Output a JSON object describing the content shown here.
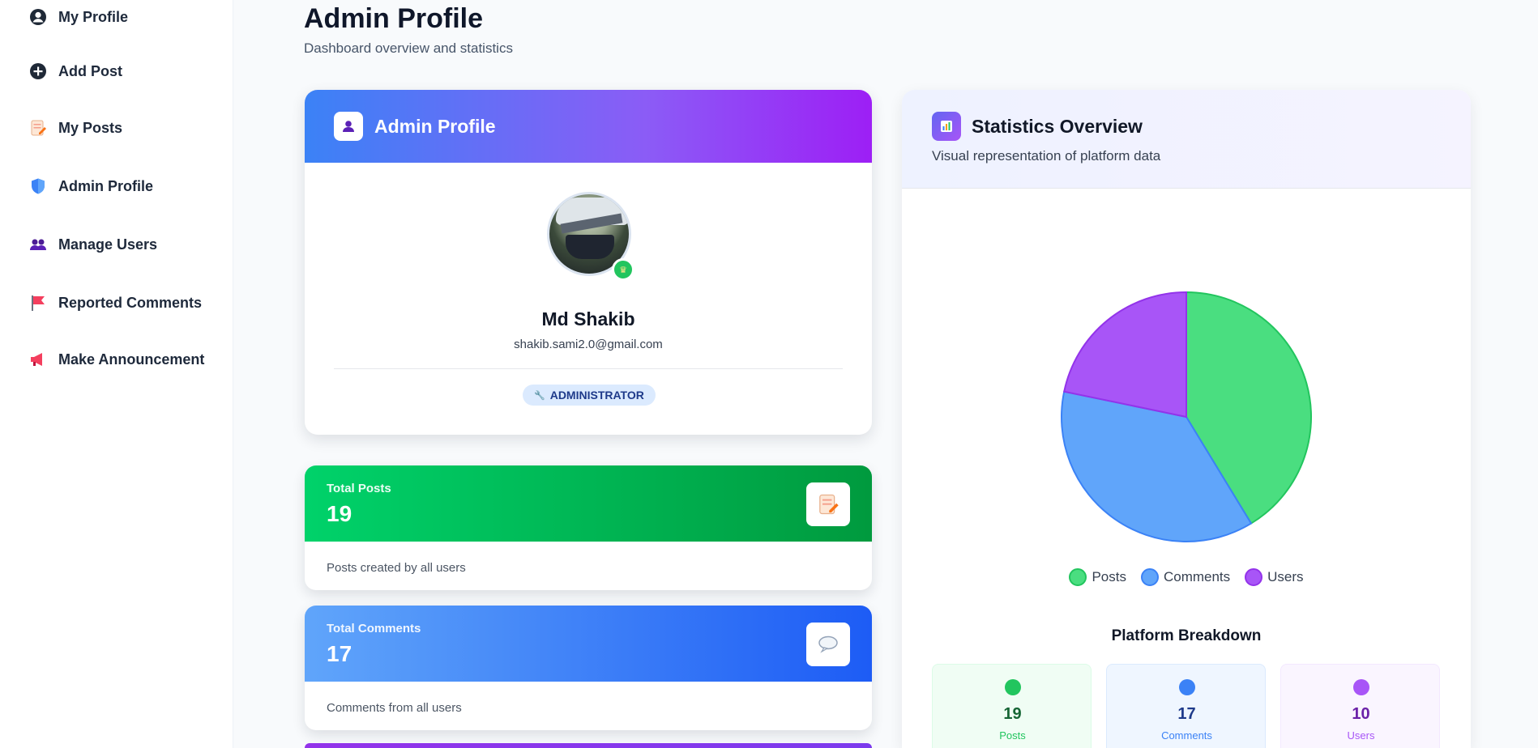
{
  "sidebar": {
    "items": [
      {
        "label": "My Profile",
        "icon": "user-circle-icon"
      },
      {
        "label": "Add Post",
        "icon": "plus-circle-icon"
      },
      {
        "label": "My Posts",
        "icon": "memo-icon"
      },
      {
        "label": "Admin Profile",
        "icon": "shield-icon"
      },
      {
        "label": "Manage Users",
        "icon": "users-icon"
      },
      {
        "label": "Reported Comments",
        "icon": "flag-icon"
      },
      {
        "label": "Make Announcement",
        "icon": "megaphone-icon"
      }
    ]
  },
  "header": {
    "title": "Admin Profile",
    "subtitle": "Dashboard overview and statistics"
  },
  "profile": {
    "card_title": "Admin Profile",
    "name": "Md Shakib",
    "email": "shakib.sami2.0@gmail.com",
    "role": "ADMINISTRATOR"
  },
  "stats_cards": [
    {
      "label": "Total Posts",
      "value": "19",
      "note": "Posts created by all users",
      "icon": "memo-icon",
      "gradient": [
        "#00d26a",
        "#009a3e"
      ]
    },
    {
      "label": "Total Comments",
      "value": "17",
      "note": "Comments from all users",
      "icon": "speech-bubble-icon",
      "gradient": [
        "#60a5fa",
        "#1d5cf5"
      ]
    }
  ],
  "statistics": {
    "title": "Statistics Overview",
    "subtitle": "Visual representation of platform data",
    "breakdown_title": "Platform Breakdown",
    "breakdown": [
      {
        "value": "19",
        "label": "Posts",
        "dot": "#22c55e",
        "bg": "#f0fdf4",
        "border": "#dcfce7",
        "text": "#166534"
      },
      {
        "value": "17",
        "label": "Comments",
        "dot": "#3b82f6",
        "bg": "#eff6ff",
        "border": "#dbeafe",
        "text": "#1e3a8a"
      },
      {
        "value": "10",
        "label": "Users",
        "dot": "#a855f7",
        "bg": "#faf5ff",
        "border": "#f3e8ff",
        "text": "#6b21a8"
      }
    ]
  },
  "chart_data": {
    "type": "pie",
    "categories": [
      "Posts",
      "Comments",
      "Users"
    ],
    "values": [
      19,
      17,
      10
    ],
    "colors": [
      "#4ade80",
      "#60a5fa",
      "#a855f7"
    ],
    "stroke_colors": [
      "#22c55e",
      "#3b82f6",
      "#9333ea"
    ],
    "legend": "bottom"
  }
}
